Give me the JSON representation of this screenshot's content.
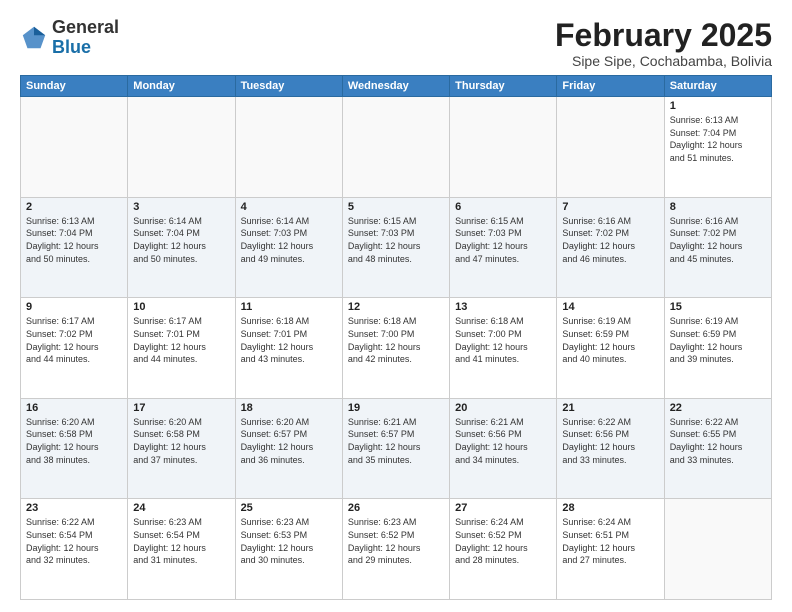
{
  "header": {
    "logo_general": "General",
    "logo_blue": "Blue",
    "title": "February 2025",
    "subtitle": "Sipe Sipe, Cochabamba, Bolivia"
  },
  "days_of_week": [
    "Sunday",
    "Monday",
    "Tuesday",
    "Wednesday",
    "Thursday",
    "Friday",
    "Saturday"
  ],
  "weeks": [
    [
      {
        "day": "",
        "info": ""
      },
      {
        "day": "",
        "info": ""
      },
      {
        "day": "",
        "info": ""
      },
      {
        "day": "",
        "info": ""
      },
      {
        "day": "",
        "info": ""
      },
      {
        "day": "",
        "info": ""
      },
      {
        "day": "1",
        "info": "Sunrise: 6:13 AM\nSunset: 7:04 PM\nDaylight: 12 hours\nand 51 minutes."
      }
    ],
    [
      {
        "day": "2",
        "info": "Sunrise: 6:13 AM\nSunset: 7:04 PM\nDaylight: 12 hours\nand 50 minutes."
      },
      {
        "day": "3",
        "info": "Sunrise: 6:14 AM\nSunset: 7:04 PM\nDaylight: 12 hours\nand 50 minutes."
      },
      {
        "day": "4",
        "info": "Sunrise: 6:14 AM\nSunset: 7:03 PM\nDaylight: 12 hours\nand 49 minutes."
      },
      {
        "day": "5",
        "info": "Sunrise: 6:15 AM\nSunset: 7:03 PM\nDaylight: 12 hours\nand 48 minutes."
      },
      {
        "day": "6",
        "info": "Sunrise: 6:15 AM\nSunset: 7:03 PM\nDaylight: 12 hours\nand 47 minutes."
      },
      {
        "day": "7",
        "info": "Sunrise: 6:16 AM\nSunset: 7:02 PM\nDaylight: 12 hours\nand 46 minutes."
      },
      {
        "day": "8",
        "info": "Sunrise: 6:16 AM\nSunset: 7:02 PM\nDaylight: 12 hours\nand 45 minutes."
      }
    ],
    [
      {
        "day": "9",
        "info": "Sunrise: 6:17 AM\nSunset: 7:02 PM\nDaylight: 12 hours\nand 44 minutes."
      },
      {
        "day": "10",
        "info": "Sunrise: 6:17 AM\nSunset: 7:01 PM\nDaylight: 12 hours\nand 44 minutes."
      },
      {
        "day": "11",
        "info": "Sunrise: 6:18 AM\nSunset: 7:01 PM\nDaylight: 12 hours\nand 43 minutes."
      },
      {
        "day": "12",
        "info": "Sunrise: 6:18 AM\nSunset: 7:00 PM\nDaylight: 12 hours\nand 42 minutes."
      },
      {
        "day": "13",
        "info": "Sunrise: 6:18 AM\nSunset: 7:00 PM\nDaylight: 12 hours\nand 41 minutes."
      },
      {
        "day": "14",
        "info": "Sunrise: 6:19 AM\nSunset: 6:59 PM\nDaylight: 12 hours\nand 40 minutes."
      },
      {
        "day": "15",
        "info": "Sunrise: 6:19 AM\nSunset: 6:59 PM\nDaylight: 12 hours\nand 39 minutes."
      }
    ],
    [
      {
        "day": "16",
        "info": "Sunrise: 6:20 AM\nSunset: 6:58 PM\nDaylight: 12 hours\nand 38 minutes."
      },
      {
        "day": "17",
        "info": "Sunrise: 6:20 AM\nSunset: 6:58 PM\nDaylight: 12 hours\nand 37 minutes."
      },
      {
        "day": "18",
        "info": "Sunrise: 6:20 AM\nSunset: 6:57 PM\nDaylight: 12 hours\nand 36 minutes."
      },
      {
        "day": "19",
        "info": "Sunrise: 6:21 AM\nSunset: 6:57 PM\nDaylight: 12 hours\nand 35 minutes."
      },
      {
        "day": "20",
        "info": "Sunrise: 6:21 AM\nSunset: 6:56 PM\nDaylight: 12 hours\nand 34 minutes."
      },
      {
        "day": "21",
        "info": "Sunrise: 6:22 AM\nSunset: 6:56 PM\nDaylight: 12 hours\nand 33 minutes."
      },
      {
        "day": "22",
        "info": "Sunrise: 6:22 AM\nSunset: 6:55 PM\nDaylight: 12 hours\nand 33 minutes."
      }
    ],
    [
      {
        "day": "23",
        "info": "Sunrise: 6:22 AM\nSunset: 6:54 PM\nDaylight: 12 hours\nand 32 minutes."
      },
      {
        "day": "24",
        "info": "Sunrise: 6:23 AM\nSunset: 6:54 PM\nDaylight: 12 hours\nand 31 minutes."
      },
      {
        "day": "25",
        "info": "Sunrise: 6:23 AM\nSunset: 6:53 PM\nDaylight: 12 hours\nand 30 minutes."
      },
      {
        "day": "26",
        "info": "Sunrise: 6:23 AM\nSunset: 6:52 PM\nDaylight: 12 hours\nand 29 minutes."
      },
      {
        "day": "27",
        "info": "Sunrise: 6:24 AM\nSunset: 6:52 PM\nDaylight: 12 hours\nand 28 minutes."
      },
      {
        "day": "28",
        "info": "Sunrise: 6:24 AM\nSunset: 6:51 PM\nDaylight: 12 hours\nand 27 minutes."
      },
      {
        "day": "",
        "info": ""
      }
    ]
  ]
}
